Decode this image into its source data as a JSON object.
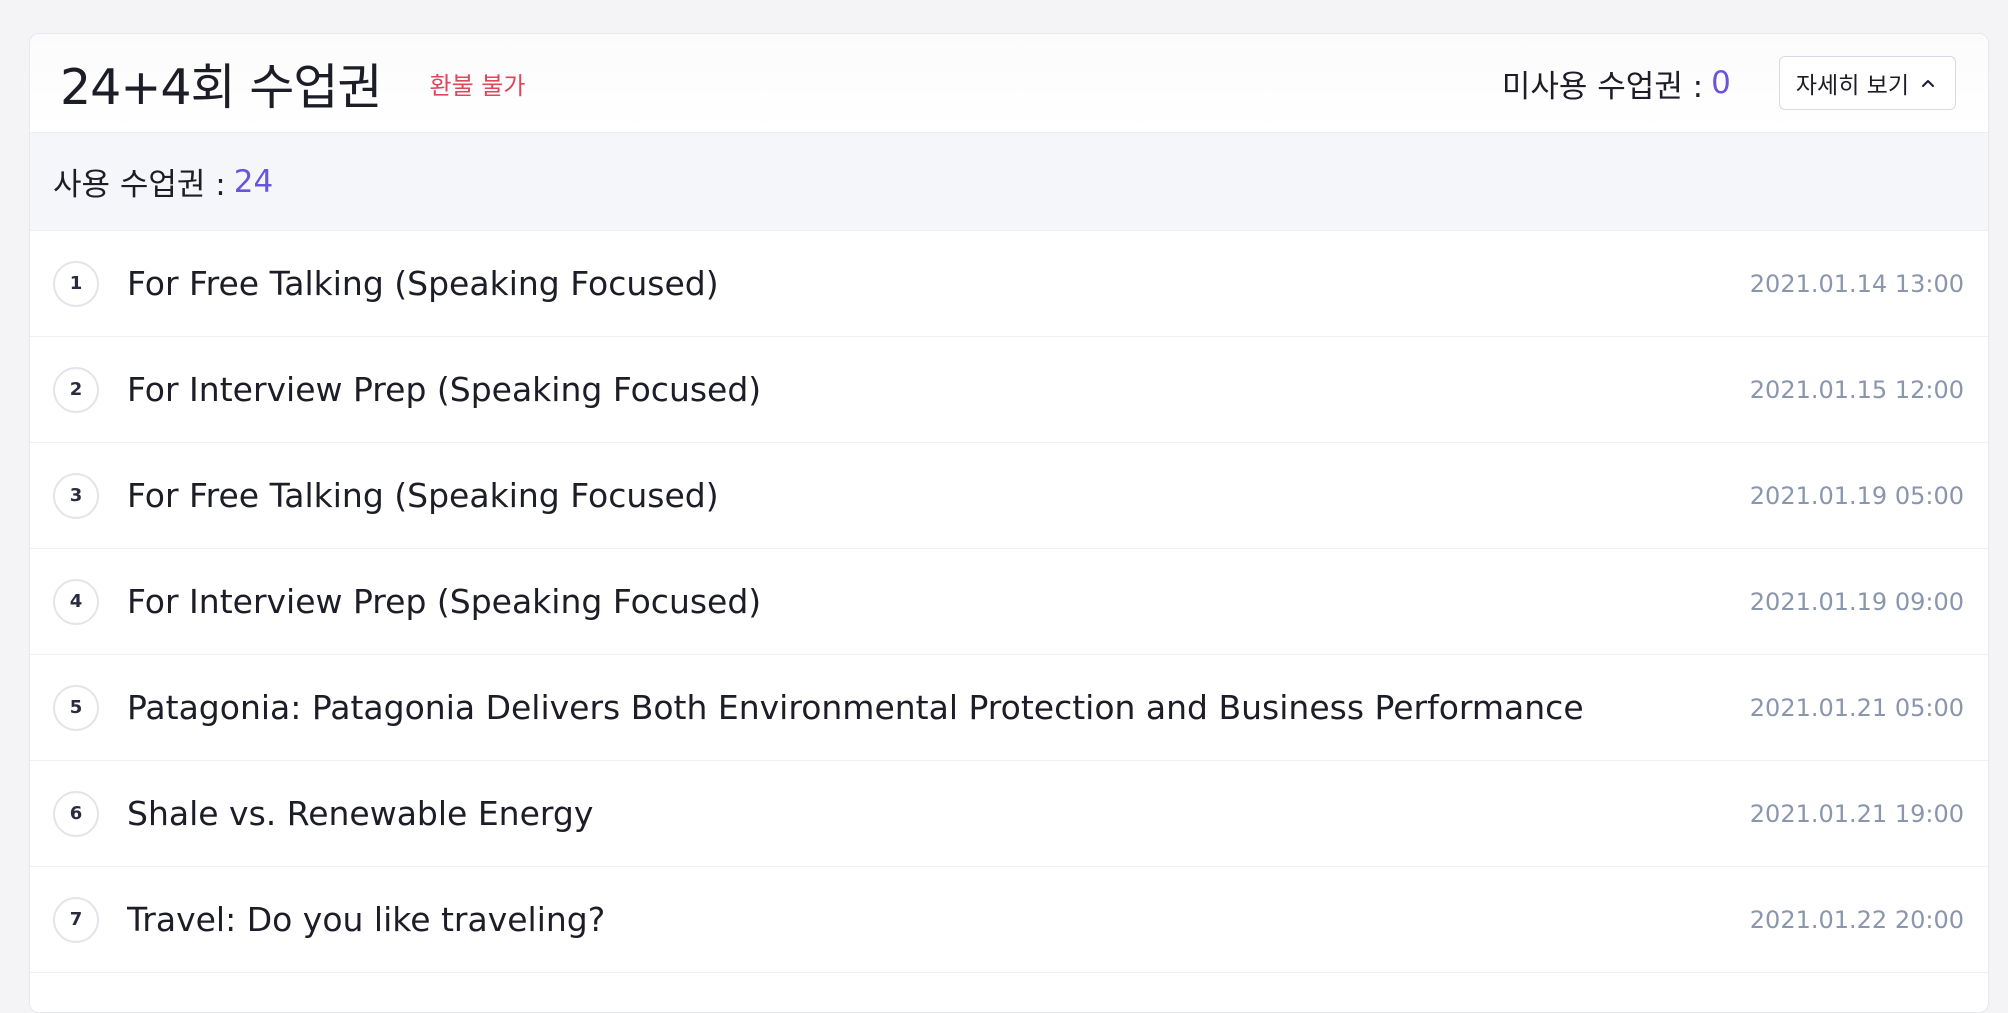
{
  "package": {
    "title": "24+4회 수업권",
    "badge": "환불 불가",
    "unused_label": "미사용 수업권 :",
    "unused_count": "0",
    "details_button": "자세히 보기",
    "used_label": "사용 수업권 :",
    "used_count": "24",
    "icons": {
      "details_toggle": "chevron-up-icon"
    },
    "colors": {
      "accent": "#6a55d8",
      "badge": "#e0465a",
      "date": "#8a96ad"
    }
  },
  "lessons": [
    {
      "num": "1",
      "title": "For Free Talking (Speaking Focused)",
      "date": "2021.01.14 13:00"
    },
    {
      "num": "2",
      "title": "For Interview Prep (Speaking Focused)",
      "date": "2021.01.15 12:00"
    },
    {
      "num": "3",
      "title": "For Free Talking (Speaking Focused)",
      "date": "2021.01.19 05:00"
    },
    {
      "num": "4",
      "title": "For Interview Prep (Speaking Focused)",
      "date": "2021.01.19 09:00"
    },
    {
      "num": "5",
      "title": "Patagonia: Patagonia Delivers Both Environmental Protection and Business Performance",
      "date": "2021.01.21 05:00"
    },
    {
      "num": "6",
      "title": "Shale vs. Renewable Energy",
      "date": "2021.01.21 19:00"
    },
    {
      "num": "7",
      "title": "Travel: Do you like traveling?",
      "date": "2021.01.22 20:00"
    }
  ]
}
